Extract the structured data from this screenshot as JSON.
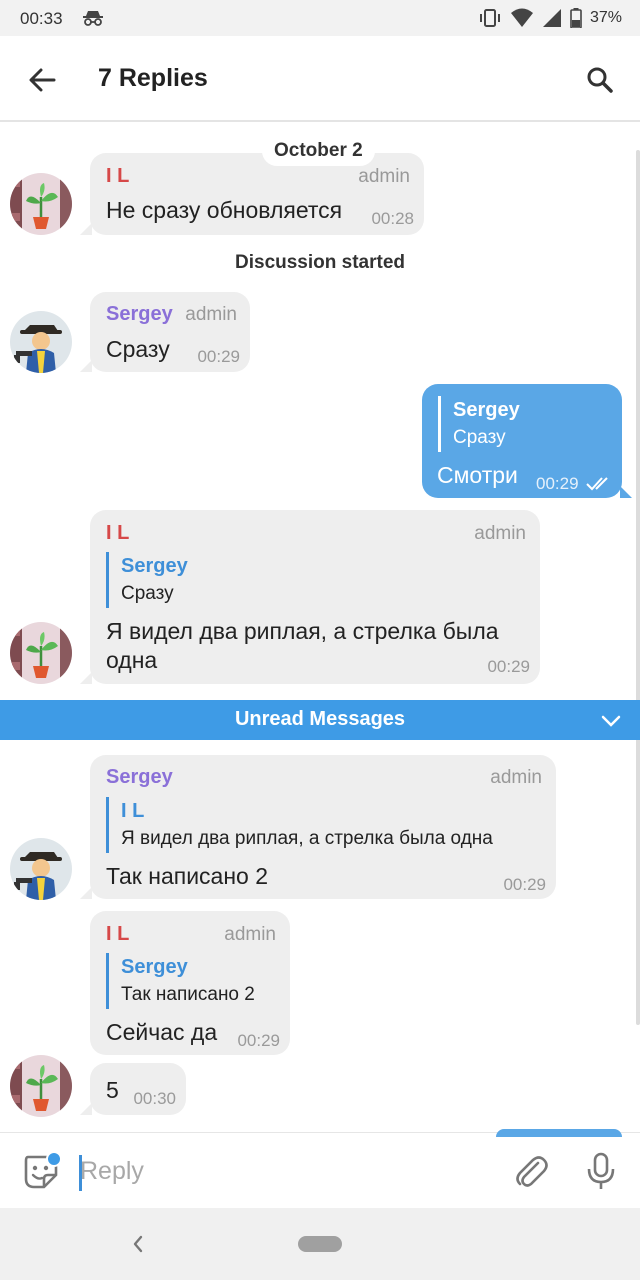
{
  "status_bar": {
    "time": "00:33",
    "battery": "37%"
  },
  "header": {
    "title": "7 Replies"
  },
  "chat": {
    "date": "October 2",
    "service_message": "Discussion started",
    "unread_label": "Unread Messages",
    "messages": [
      {
        "sender": "I L",
        "role": "admin",
        "text": "Не сразу обновляется",
        "time": "00:28"
      },
      {
        "sender": "Sergey",
        "role": "admin",
        "text": "Сразу",
        "time": "00:29"
      },
      {
        "reply_to": {
          "name": "Sergey",
          "text": "Сразу"
        },
        "text": "Смотри",
        "time": "00:29"
      },
      {
        "sender": "I L",
        "role": "admin",
        "reply_to": {
          "name": "Sergey",
          "text": "Сразу"
        },
        "text_line1": "Я видел два риплая, а стрелка была",
        "text_line2": "одна",
        "time": "00:29"
      },
      {
        "sender": "Sergey",
        "role": "admin",
        "reply_to": {
          "name": "I L",
          "text": "Я видел два риплая, а стрелка была одна"
        },
        "text": "Так написано 2",
        "time": "00:29"
      },
      {
        "sender": "I L",
        "role": "admin",
        "reply_to": {
          "name": "Sergey",
          "text": "Так написано 2"
        },
        "text": "Сейчас да",
        "time": "00:29"
      },
      {
        "text": "5",
        "time": "00:30"
      }
    ]
  },
  "input": {
    "placeholder": "Reply"
  },
  "icons": {
    "back": "arrow-left-icon",
    "search": "search-icon",
    "sticker": "sticker-icon",
    "attach": "paperclip-icon",
    "mic": "microphone-icon",
    "read_receipt": "double-check-icon"
  },
  "colors": {
    "accent": "#3e9be6",
    "outgoing_bubble": "#5aa7e6",
    "incoming_bubble": "#eeeeee",
    "name_red": "#d64848",
    "name_purple": "#8a70d8"
  }
}
